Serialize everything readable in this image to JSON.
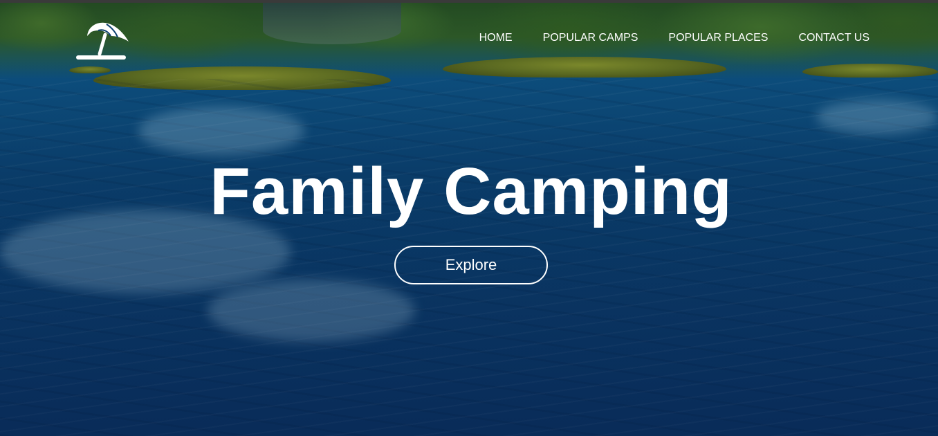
{
  "nav": {
    "items": [
      {
        "label": "HOME"
      },
      {
        "label": "POPULAR CAMPS"
      },
      {
        "label": "POPULAR PLACES"
      },
      {
        "label": "CONTACT US"
      }
    ]
  },
  "hero": {
    "title": "Family Camping",
    "button_label": "Explore",
    "background": "river-forest-photo"
  },
  "logo": {
    "icon": "beach-umbrella-icon"
  },
  "colors": {
    "text": "#ffffff",
    "water": "#0b3f6e",
    "forest": "#2c5827"
  }
}
